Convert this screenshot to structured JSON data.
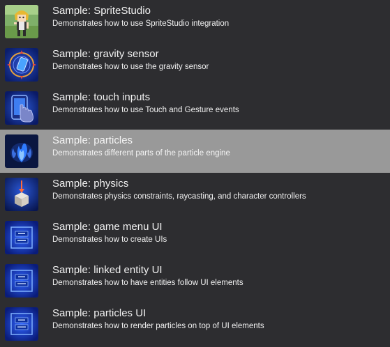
{
  "samples": [
    {
      "title": "Sample: SpriteStudio",
      "description": "Demonstrates how to use SpriteStudio integration",
      "icon": "spritestudio-character-icon",
      "selected": false
    },
    {
      "title": "Sample: gravity sensor",
      "description": "Demonstrates how to use the gravity sensor",
      "icon": "gravity-sensor-icon",
      "selected": false
    },
    {
      "title": "Sample: touch inputs",
      "description": "Demonstrates how to use Touch and Gesture events",
      "icon": "touch-hand-icon",
      "selected": false
    },
    {
      "title": "Sample: particles",
      "description": "Demonstrates different parts of the particle engine",
      "icon": "particles-flame-icon",
      "selected": true
    },
    {
      "title": "Sample: physics",
      "description": "Demonstrates physics constraints, raycasting, and character controllers",
      "icon": "physics-cube-icon",
      "selected": false
    },
    {
      "title": "Sample: game menu UI",
      "description": "Demonstrates how to create UIs",
      "icon": "ui-panel-icon",
      "selected": false
    },
    {
      "title": "Sample: linked entity UI",
      "description": "Demonstrates how to have entities follow UI elements",
      "icon": "ui-panel-icon",
      "selected": false
    },
    {
      "title": "Sample: particles UI",
      "description": "Demonstrates how to render particles on top of UI elements",
      "icon": "ui-panel-icon",
      "selected": false
    }
  ],
  "colors": {
    "background": "#2d2d30",
    "selected_background": "#999999",
    "text": "#f1f1f1"
  }
}
